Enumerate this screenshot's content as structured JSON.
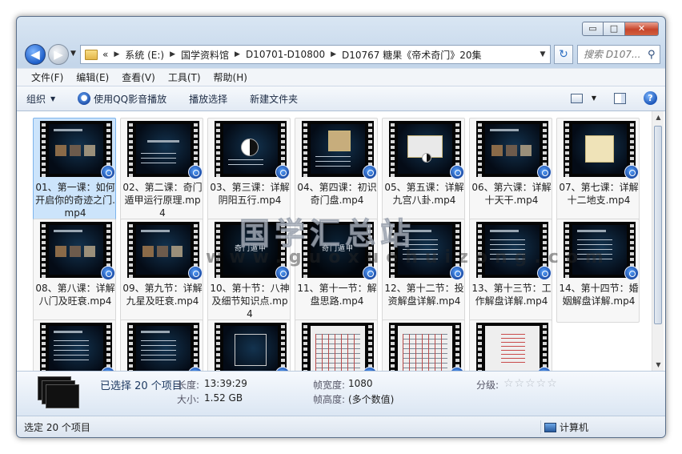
{
  "window": {
    "minimize": "▭",
    "maximize": "□",
    "close": "✕"
  },
  "nav": {
    "back": "◀",
    "forward": "▶",
    "breadcrumbs": [
      "系统 (E:)",
      "国学资料馆",
      "D10701-D10800",
      "D10767 糖果《帝术奇门》20集"
    ],
    "overflow": "«",
    "search_placeholder": "搜索 D107..."
  },
  "menu": [
    "文件(F)",
    "编辑(E)",
    "查看(V)",
    "工具(T)",
    "帮助(H)"
  ],
  "toolbar": {
    "organize": "组织",
    "play_qq": "使用QQ影音播放",
    "play_selected": "播放选择",
    "new_folder": "新建文件夹"
  },
  "files": [
    "01、第一课：如何开启你的奇迹之门.mp4",
    "02、第二课：奇门遁甲运行原理.mp4",
    "03、第三课：详解阴阳五行.mp4",
    "04、第四课：初识奇门盘.mp4",
    "05、第五课：详解九宫八卦.mp4",
    "06、第六课：详解十天干.mp4",
    "07、第七课：详解十二地支.mp4",
    "08、第八课：详解八门及旺衰.mp4",
    "09、第九节：详解九星及旺衰.mp4",
    "10、第十节：八神及细节知识点.mp4",
    "11、第十一节：解盘思路.mp4",
    "12、第十二节：投资解盘详解.mp4",
    "13、第十三节：工作解盘详解.mp4",
    "14、第十四节：婚姻解盘详解.mp4",
    "",
    "",
    "",
    "",
    "",
    ""
  ],
  "thumb_titles": {
    "t10": "奇门遁甲",
    "t11": "奇门遁甲"
  },
  "watermark": {
    "text": "国学汇总站",
    "url": "www.guoxuehuizong.com"
  },
  "details": {
    "selected": "已选择 20 个项目",
    "length_label": "长度:",
    "length": "13:39:29",
    "size_label": "大小:",
    "size": "1.52 GB",
    "width_label": "帧宽度:",
    "width": "1080",
    "height_label": "帧高度:",
    "height": "(多个数值)",
    "rating_label": "分级:",
    "rating": 0,
    "rating_stars": "☆☆☆☆☆"
  },
  "status": {
    "left": "选定 20 个项目",
    "right": "计算机"
  }
}
